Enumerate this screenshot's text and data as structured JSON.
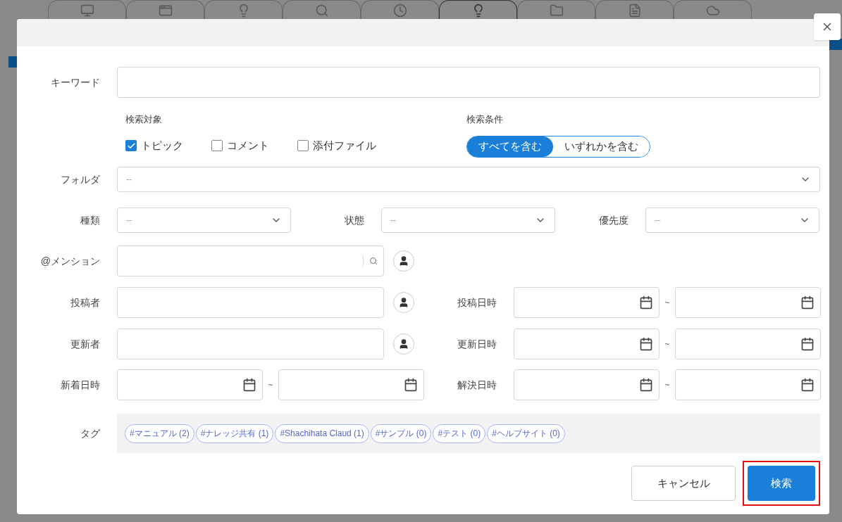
{
  "background_tabs": [
    {
      "selected": false
    },
    {
      "selected": false
    },
    {
      "selected": false
    },
    {
      "selected": false
    },
    {
      "selected": false
    },
    {
      "selected": true
    },
    {
      "selected": false
    },
    {
      "selected": false
    },
    {
      "selected": false
    }
  ],
  "keyword": {
    "label": "キーワード"
  },
  "search_target": {
    "label": "検索対象",
    "options": [
      {
        "label": "トピック",
        "checked": true
      },
      {
        "label": "コメント",
        "checked": false
      },
      {
        "label": "添付ファイル",
        "checked": false
      }
    ]
  },
  "search_condition": {
    "label": "検索条件",
    "options": [
      {
        "label": "すべてを含む",
        "selected": true
      },
      {
        "label": "いずれかを含む",
        "selected": false
      }
    ]
  },
  "folder": {
    "label": "フォルダ",
    "value": "--"
  },
  "selects": [
    {
      "label": "種類",
      "value": "--"
    },
    {
      "label": "状態",
      "value": "--"
    },
    {
      "label": "優先度",
      "value": "--"
    }
  ],
  "mention": {
    "label": "@メンション"
  },
  "people_rows": [
    {
      "label": "投稿者",
      "date_label": "投稿日時",
      "separator": "~"
    },
    {
      "label": "更新者",
      "date_label": "更新日時",
      "separator": "~"
    }
  ],
  "new_date": {
    "label": "新着日時",
    "separator": "~"
  },
  "resolved_date": {
    "label": "解決日時",
    "separator": "~"
  },
  "tags": {
    "label": "タグ",
    "items": [
      "#マニュアル (2)",
      "#ナレッジ共有 (1)",
      "#Shachihata Claud (1)",
      "#サンプル (0)",
      "#テスト (0)",
      "#ヘルプサイト (0)"
    ]
  },
  "buttons": [
    {
      "label": "キャンセル",
      "kind": "secondary",
      "highlighted": false
    },
    {
      "label": "検索",
      "kind": "primary",
      "highlighted": true
    }
  ]
}
